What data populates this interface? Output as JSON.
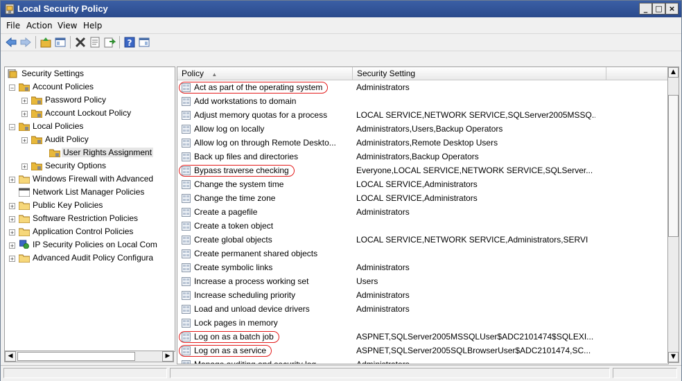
{
  "window": {
    "title": "Local Security Policy",
    "minimize": "_",
    "maximize": "□",
    "close": "×"
  },
  "menu": [
    "File",
    "Action",
    "View",
    "Help"
  ],
  "tree": {
    "items": [
      {
        "label": "Security Settings",
        "level": 0,
        "expander": "",
        "selected": false
      },
      {
        "label": "Account Policies",
        "level": 1,
        "expander": "−",
        "selected": false
      },
      {
        "label": "Password Policy",
        "level": 2,
        "expander": "+",
        "selected": false
      },
      {
        "label": "Account Lockout Policy",
        "level": 2,
        "expander": "+",
        "selected": false
      },
      {
        "label": "Local Policies",
        "level": 1,
        "expander": "−",
        "selected": false
      },
      {
        "label": "Audit Policy",
        "level": 2,
        "expander": "+",
        "selected": false
      },
      {
        "label": "User Rights Assignment",
        "level": 3,
        "expander": "",
        "selected": true
      },
      {
        "label": "Security Options",
        "level": 2,
        "expander": "+",
        "selected": false
      },
      {
        "label": "Windows Firewall with Advanced",
        "level": 1,
        "expander": "+",
        "selected": false
      },
      {
        "label": "Network List Manager Policies",
        "level": 1,
        "expander": "",
        "selected": false
      },
      {
        "label": "Public Key Policies",
        "level": 1,
        "expander": "+",
        "selected": false
      },
      {
        "label": "Software Restriction Policies",
        "level": 1,
        "expander": "+",
        "selected": false
      },
      {
        "label": "Application Control Policies",
        "level": 1,
        "expander": "+",
        "selected": false
      },
      {
        "label": "IP Security Policies on Local Com",
        "level": 1,
        "expander": "+",
        "selected": false
      },
      {
        "label": "Advanced Audit Policy Configura",
        "level": 1,
        "expander": "+",
        "selected": false
      }
    ]
  },
  "list": {
    "columns": [
      "Policy",
      "Security Setting"
    ],
    "sort_indicator": "▲",
    "rows": [
      {
        "policy": "Act as part of the operating system",
        "setting": "Administrators",
        "circled": true
      },
      {
        "policy": "Add workstations to domain",
        "setting": "",
        "circled": false
      },
      {
        "policy": "Adjust memory quotas for a process",
        "setting": "LOCAL SERVICE,NETWORK SERVICE,SQLServer2005MSSQ...",
        "circled": false
      },
      {
        "policy": "Allow log on locally",
        "setting": "Administrators,Users,Backup Operators",
        "circled": false
      },
      {
        "policy": "Allow log on through Remote Deskto...",
        "setting": "Administrators,Remote Desktop Users",
        "circled": false
      },
      {
        "policy": "Back up files and directories",
        "setting": "Administrators,Backup Operators",
        "circled": false
      },
      {
        "policy": "Bypass traverse checking",
        "setting": "Everyone,LOCAL SERVICE,NETWORK SERVICE,SQLServer...",
        "circled": true
      },
      {
        "policy": "Change the system time",
        "setting": "LOCAL SERVICE,Administrators",
        "circled": false
      },
      {
        "policy": "Change the time zone",
        "setting": "LOCAL SERVICE,Administrators",
        "circled": false
      },
      {
        "policy": "Create a pagefile",
        "setting": "Administrators",
        "circled": false
      },
      {
        "policy": "Create a token object",
        "setting": "",
        "circled": false
      },
      {
        "policy": "Create global objects",
        "setting": "LOCAL SERVICE,NETWORK SERVICE,Administrators,SERVI",
        "circled": false
      },
      {
        "policy": "Create permanent shared objects",
        "setting": "",
        "circled": false
      },
      {
        "policy": "Create symbolic links",
        "setting": "Administrators",
        "circled": false
      },
      {
        "policy": "Increase a process working set",
        "setting": "Users",
        "circled": false
      },
      {
        "policy": "Increase scheduling priority",
        "setting": "Administrators",
        "circled": false
      },
      {
        "policy": "Load and unload device drivers",
        "setting": "Administrators",
        "circled": false
      },
      {
        "policy": "Lock pages in memory",
        "setting": "",
        "circled": false
      },
      {
        "policy": "Log on as a batch job",
        "setting": "ASPNET,SQLServer2005MSSQLUser$ADC2101474$SQLEXI...",
        "circled": true
      },
      {
        "policy": "Log on as a service",
        "setting": "ASPNET,SQLServer2005SQLBrowserUser$ADC2101474,SC...",
        "circled": true
      },
      {
        "policy": "Manage auditing and security log",
        "setting": "Administrators",
        "circled": false
      }
    ]
  },
  "colors": {
    "title_bar": "#2a4a8c",
    "highlight": "#e31b1b",
    "folder": "#e8b83a"
  }
}
